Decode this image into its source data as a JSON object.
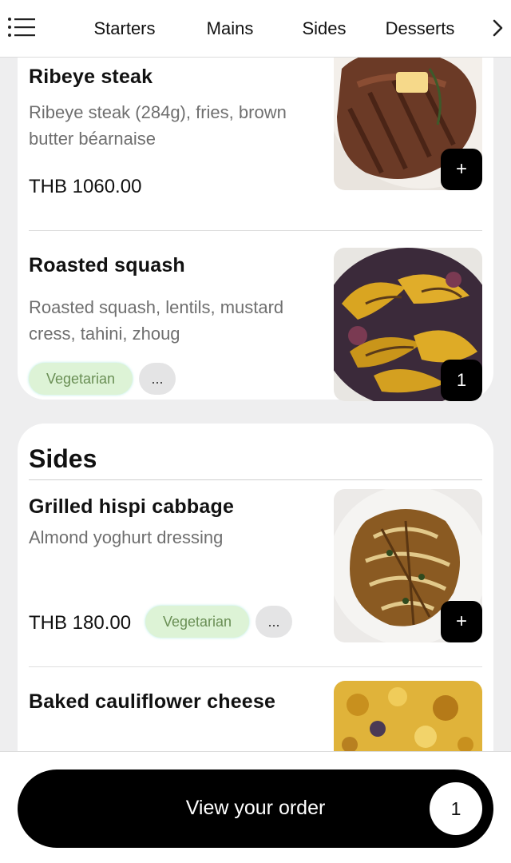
{
  "nav": {
    "tabs": [
      "Starters",
      "Mains",
      "Sides",
      "Desserts"
    ]
  },
  "mains": {
    "items": [
      {
        "title": "Ribeye steak",
        "description": "Ribeye steak (284g), fries, brown butter béarnaise",
        "price": "THB 1060.00",
        "action": "+"
      },
      {
        "title": "Roasted squash",
        "description": "Roasted squash, lentils, mustard cress, tahini, zhoug",
        "badge": "Vegetarian",
        "more": "...",
        "quantity": "1"
      }
    ]
  },
  "sides": {
    "title": "Sides",
    "items": [
      {
        "title": "Grilled hispi cabbage",
        "description": "Almond yoghurt dressing",
        "price": "THB 180.00",
        "badge": "Vegetarian",
        "more": "...",
        "action": "+"
      },
      {
        "title": "Baked cauliflower cheese"
      }
    ]
  },
  "order": {
    "label": "View your order",
    "count": "1"
  }
}
